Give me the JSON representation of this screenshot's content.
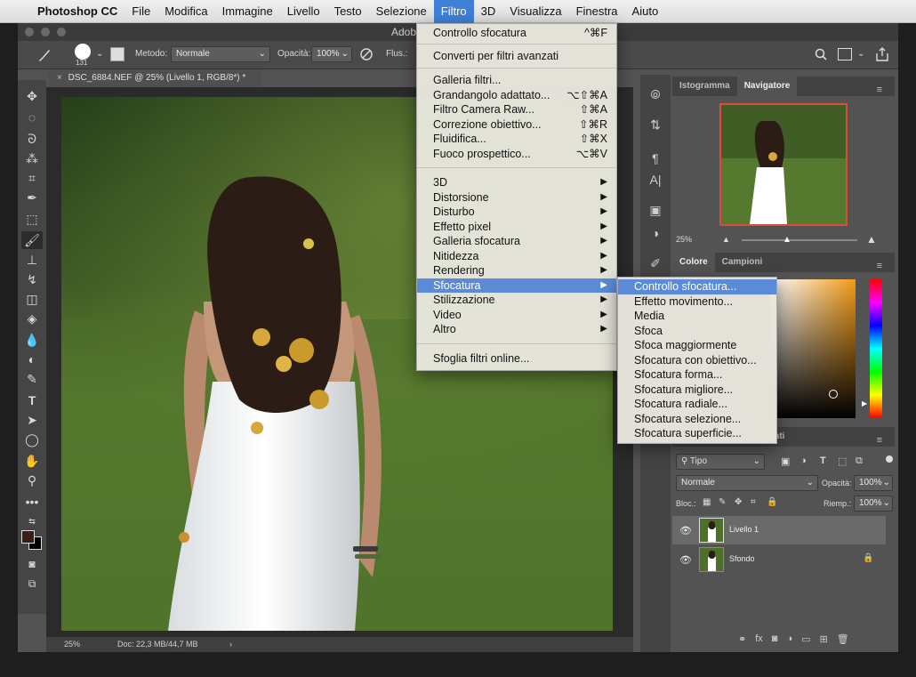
{
  "menubar": {
    "app": "Photoshop CC",
    "items": [
      "File",
      "Modifica",
      "Immagine",
      "Livello",
      "Testo",
      "Selezione",
      "Filtro",
      "3D",
      "Visualizza",
      "Finestra",
      "Aiuto"
    ]
  },
  "window": {
    "title": "Adob"
  },
  "options": {
    "brush_size": "131",
    "metodo_label": "Metodo:",
    "metodo_value": "Normale",
    "opacita_label": "Opacità:",
    "opacita_value": "100%",
    "flusso_label": "Flus.:"
  },
  "document": {
    "tab": "DSC_6884.NEF @ 25% (Livello 1, RGB/8*) *",
    "zoom": "25%",
    "doc_info": "Doc: 22,3 MB/44,7 MB"
  },
  "filter_menu": {
    "items": [
      {
        "label": "Controllo sfocatura",
        "shortcut": "^⌘F"
      },
      {
        "label": "Converti per filtri avanzati",
        "shortcut": ""
      },
      {
        "label": "Galleria filtri...",
        "shortcut": ""
      },
      {
        "label": "Grandangolo adattato...",
        "shortcut": "⌥⇧⌘A"
      },
      {
        "label": "Filtro Camera Raw...",
        "shortcut": "⇧⌘A"
      },
      {
        "label": "Correzione obiettivo...",
        "shortcut": "⇧⌘R"
      },
      {
        "label": "Fluidifica...",
        "shortcut": "⇧⌘X"
      },
      {
        "label": "Fuoco prospettico...",
        "shortcut": "⌥⌘V"
      },
      {
        "label": "3D",
        "shortcut": ""
      },
      {
        "label": "Distorsione",
        "shortcut": ""
      },
      {
        "label": "Disturbo",
        "shortcut": ""
      },
      {
        "label": "Effetto pixel",
        "shortcut": ""
      },
      {
        "label": "Galleria sfocatura",
        "shortcut": ""
      },
      {
        "label": "Nitidezza",
        "shortcut": ""
      },
      {
        "label": "Rendering",
        "shortcut": ""
      },
      {
        "label": "Sfocatura",
        "shortcut": ""
      },
      {
        "label": "Stilizzazione",
        "shortcut": ""
      },
      {
        "label": "Video",
        "shortcut": ""
      },
      {
        "label": "Altro",
        "shortcut": ""
      },
      {
        "label": "Sfoglia filtri online...",
        "shortcut": ""
      }
    ],
    "highlighted": "Sfocatura"
  },
  "blur_submenu": {
    "items": [
      "Controllo sfocatura...",
      "Effetto movimento...",
      "Media",
      "Sfoca",
      "Sfoca maggiormente",
      "Sfocatura con obiettivo...",
      "Sfocatura forma...",
      "Sfocatura migliore...",
      "Sfocatura radiale...",
      "Sfocatura selezione...",
      "Sfocatura superficie..."
    ],
    "highlighted": "Controllo sfocatura..."
  },
  "navigator_panel": {
    "tabs": [
      "Istogramma",
      "Navigatore"
    ],
    "zoom": "25%"
  },
  "color_panel": {
    "tabs": [
      "Colore",
      "Campioni"
    ],
    "hue_color": "#f39a16"
  },
  "layers_panel": {
    "partial_tab": "iati",
    "filter_label": "Tipo",
    "blend_mode": "Normale",
    "opacity_label": "Opacità:",
    "opacity_value": "100%",
    "lock_label": "Bloc.:",
    "fill_label": "Riemp.:",
    "fill_value": "100%",
    "layers": [
      {
        "name": "Livello 1",
        "selected": true
      },
      {
        "name": "Sfondo",
        "selected": false
      }
    ]
  }
}
